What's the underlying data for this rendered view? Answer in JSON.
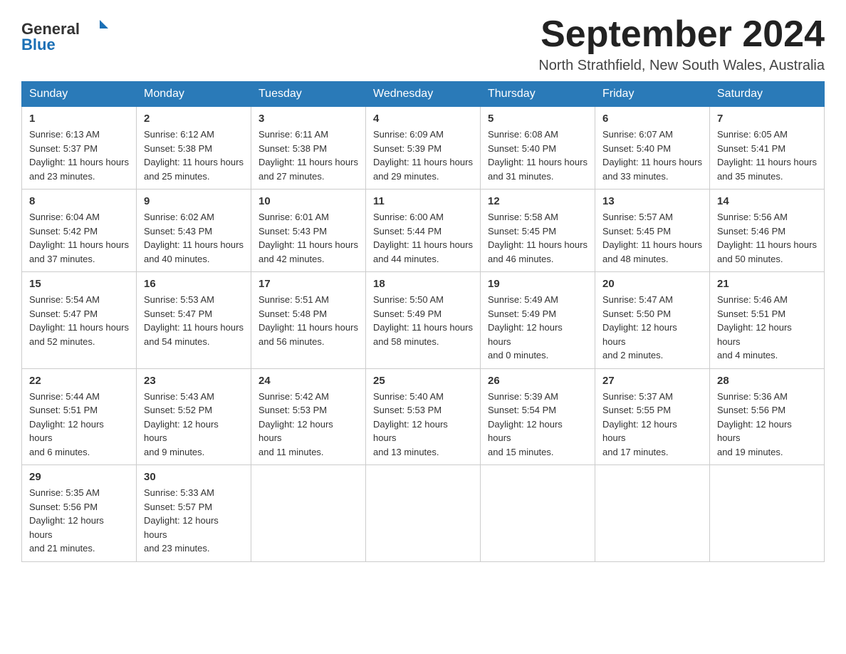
{
  "header": {
    "logo_general": "General",
    "logo_blue": "Blue",
    "month_title": "September 2024",
    "location": "North Strathfield, New South Wales, Australia"
  },
  "weekdays": [
    "Sunday",
    "Monday",
    "Tuesday",
    "Wednesday",
    "Thursday",
    "Friday",
    "Saturday"
  ],
  "weeks": [
    [
      {
        "day": 1,
        "sunrise": "6:13 AM",
        "sunset": "5:37 PM",
        "daylight": "11 hours and 23 minutes."
      },
      {
        "day": 2,
        "sunrise": "6:12 AM",
        "sunset": "5:38 PM",
        "daylight": "11 hours and 25 minutes."
      },
      {
        "day": 3,
        "sunrise": "6:11 AM",
        "sunset": "5:38 PM",
        "daylight": "11 hours and 27 minutes."
      },
      {
        "day": 4,
        "sunrise": "6:09 AM",
        "sunset": "5:39 PM",
        "daylight": "11 hours and 29 minutes."
      },
      {
        "day": 5,
        "sunrise": "6:08 AM",
        "sunset": "5:40 PM",
        "daylight": "11 hours and 31 minutes."
      },
      {
        "day": 6,
        "sunrise": "6:07 AM",
        "sunset": "5:40 PM",
        "daylight": "11 hours and 33 minutes."
      },
      {
        "day": 7,
        "sunrise": "6:05 AM",
        "sunset": "5:41 PM",
        "daylight": "11 hours and 35 minutes."
      }
    ],
    [
      {
        "day": 8,
        "sunrise": "6:04 AM",
        "sunset": "5:42 PM",
        "daylight": "11 hours and 37 minutes."
      },
      {
        "day": 9,
        "sunrise": "6:02 AM",
        "sunset": "5:43 PM",
        "daylight": "11 hours and 40 minutes."
      },
      {
        "day": 10,
        "sunrise": "6:01 AM",
        "sunset": "5:43 PM",
        "daylight": "11 hours and 42 minutes."
      },
      {
        "day": 11,
        "sunrise": "6:00 AM",
        "sunset": "5:44 PM",
        "daylight": "11 hours and 44 minutes."
      },
      {
        "day": 12,
        "sunrise": "5:58 AM",
        "sunset": "5:45 PM",
        "daylight": "11 hours and 46 minutes."
      },
      {
        "day": 13,
        "sunrise": "5:57 AM",
        "sunset": "5:45 PM",
        "daylight": "11 hours and 48 minutes."
      },
      {
        "day": 14,
        "sunrise": "5:56 AM",
        "sunset": "5:46 PM",
        "daylight": "11 hours and 50 minutes."
      }
    ],
    [
      {
        "day": 15,
        "sunrise": "5:54 AM",
        "sunset": "5:47 PM",
        "daylight": "11 hours and 52 minutes."
      },
      {
        "day": 16,
        "sunrise": "5:53 AM",
        "sunset": "5:47 PM",
        "daylight": "11 hours and 54 minutes."
      },
      {
        "day": 17,
        "sunrise": "5:51 AM",
        "sunset": "5:48 PM",
        "daylight": "11 hours and 56 minutes."
      },
      {
        "day": 18,
        "sunrise": "5:50 AM",
        "sunset": "5:49 PM",
        "daylight": "11 hours and 58 minutes."
      },
      {
        "day": 19,
        "sunrise": "5:49 AM",
        "sunset": "5:49 PM",
        "daylight": "12 hours and 0 minutes."
      },
      {
        "day": 20,
        "sunrise": "5:47 AM",
        "sunset": "5:50 PM",
        "daylight": "12 hours and 2 minutes."
      },
      {
        "day": 21,
        "sunrise": "5:46 AM",
        "sunset": "5:51 PM",
        "daylight": "12 hours and 4 minutes."
      }
    ],
    [
      {
        "day": 22,
        "sunrise": "5:44 AM",
        "sunset": "5:51 PM",
        "daylight": "12 hours and 6 minutes."
      },
      {
        "day": 23,
        "sunrise": "5:43 AM",
        "sunset": "5:52 PM",
        "daylight": "12 hours and 9 minutes."
      },
      {
        "day": 24,
        "sunrise": "5:42 AM",
        "sunset": "5:53 PM",
        "daylight": "12 hours and 11 minutes."
      },
      {
        "day": 25,
        "sunrise": "5:40 AM",
        "sunset": "5:53 PM",
        "daylight": "12 hours and 13 minutes."
      },
      {
        "day": 26,
        "sunrise": "5:39 AM",
        "sunset": "5:54 PM",
        "daylight": "12 hours and 15 minutes."
      },
      {
        "day": 27,
        "sunrise": "5:37 AM",
        "sunset": "5:55 PM",
        "daylight": "12 hours and 17 minutes."
      },
      {
        "day": 28,
        "sunrise": "5:36 AM",
        "sunset": "5:56 PM",
        "daylight": "12 hours and 19 minutes."
      }
    ],
    [
      {
        "day": 29,
        "sunrise": "5:35 AM",
        "sunset": "5:56 PM",
        "daylight": "12 hours and 21 minutes."
      },
      {
        "day": 30,
        "sunrise": "5:33 AM",
        "sunset": "5:57 PM",
        "daylight": "12 hours and 23 minutes."
      },
      null,
      null,
      null,
      null,
      null
    ]
  ],
  "labels": {
    "sunrise": "Sunrise:",
    "sunset": "Sunset:",
    "daylight": "Daylight:"
  }
}
